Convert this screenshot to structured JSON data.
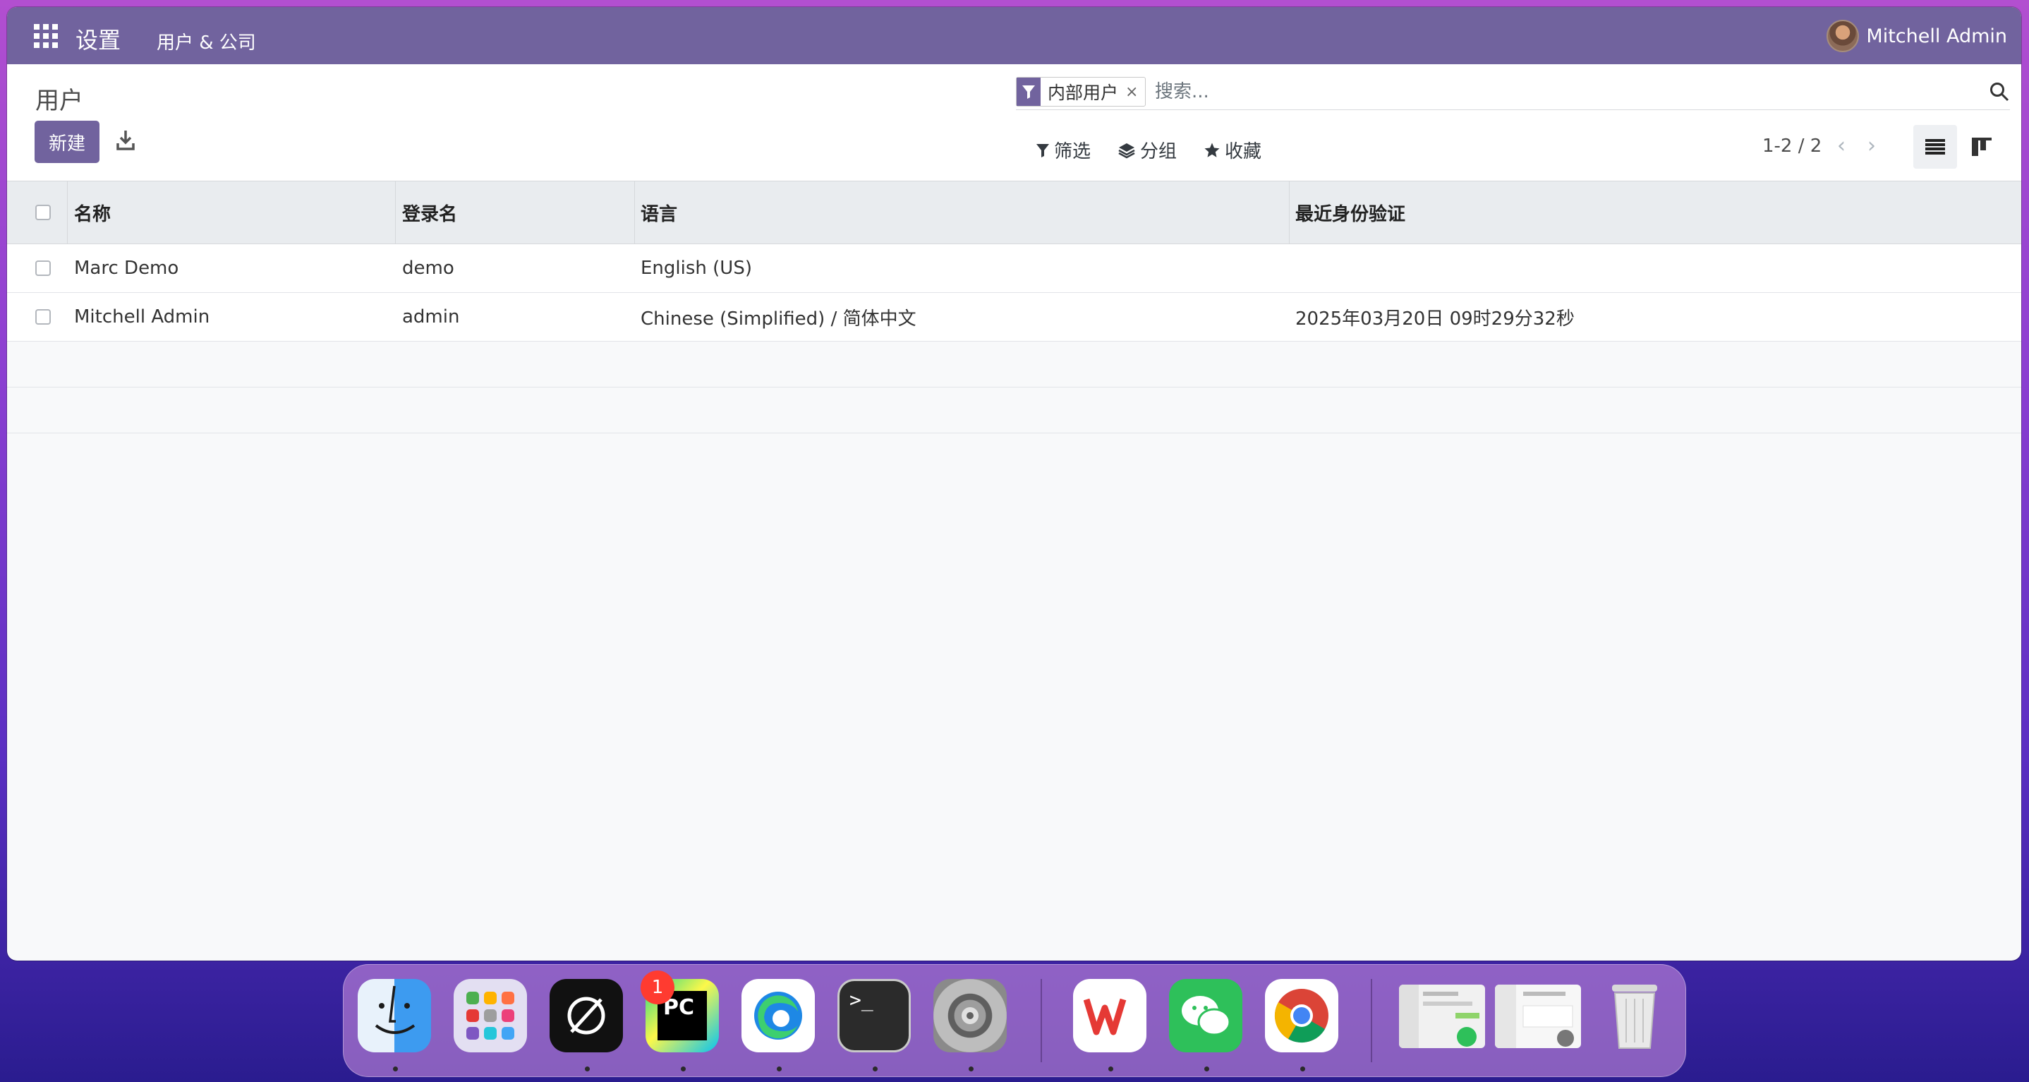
{
  "navbar": {
    "brand": "设置",
    "menu_item": "用户 & 公司",
    "user_name": "Mitchell Admin"
  },
  "control_panel": {
    "title": "用户",
    "new_button": "新建",
    "facet_label": "内部用户",
    "facet_remove": "×",
    "search_placeholder": "搜索...",
    "filters_label": "筛选",
    "groupby_label": "分组",
    "favorites_label": "收藏",
    "pager": "1-2 / 2"
  },
  "table": {
    "columns": [
      "名称",
      "登录名",
      "语言",
      "最近身份验证"
    ],
    "rows": [
      {
        "name": "Marc Demo",
        "login": "demo",
        "lang": "English (US)",
        "last_auth": ""
      },
      {
        "name": "Mitchell Admin",
        "login": "admin",
        "lang": "Chinese (Simplified) / 简体中文",
        "last_auth": "2025年03月20日 09时29分32秒"
      }
    ]
  },
  "dock": {
    "apps": [
      "finder-icon",
      "launchpad-icon",
      "perplexity-icon",
      "pycharm-icon",
      "edge-icon",
      "terminal-icon",
      "system-settings-icon",
      "wps-icon",
      "wechat-icon",
      "chrome-icon",
      "window-thumbnail-wechat",
      "window-thumbnail-settings",
      "trash-icon"
    ],
    "pycharm_text": "PC",
    "terminal_text": ">_",
    "settings_badge": "1"
  },
  "colors": {
    "brand": "#71639e",
    "header_bg": "#e9ecef"
  }
}
